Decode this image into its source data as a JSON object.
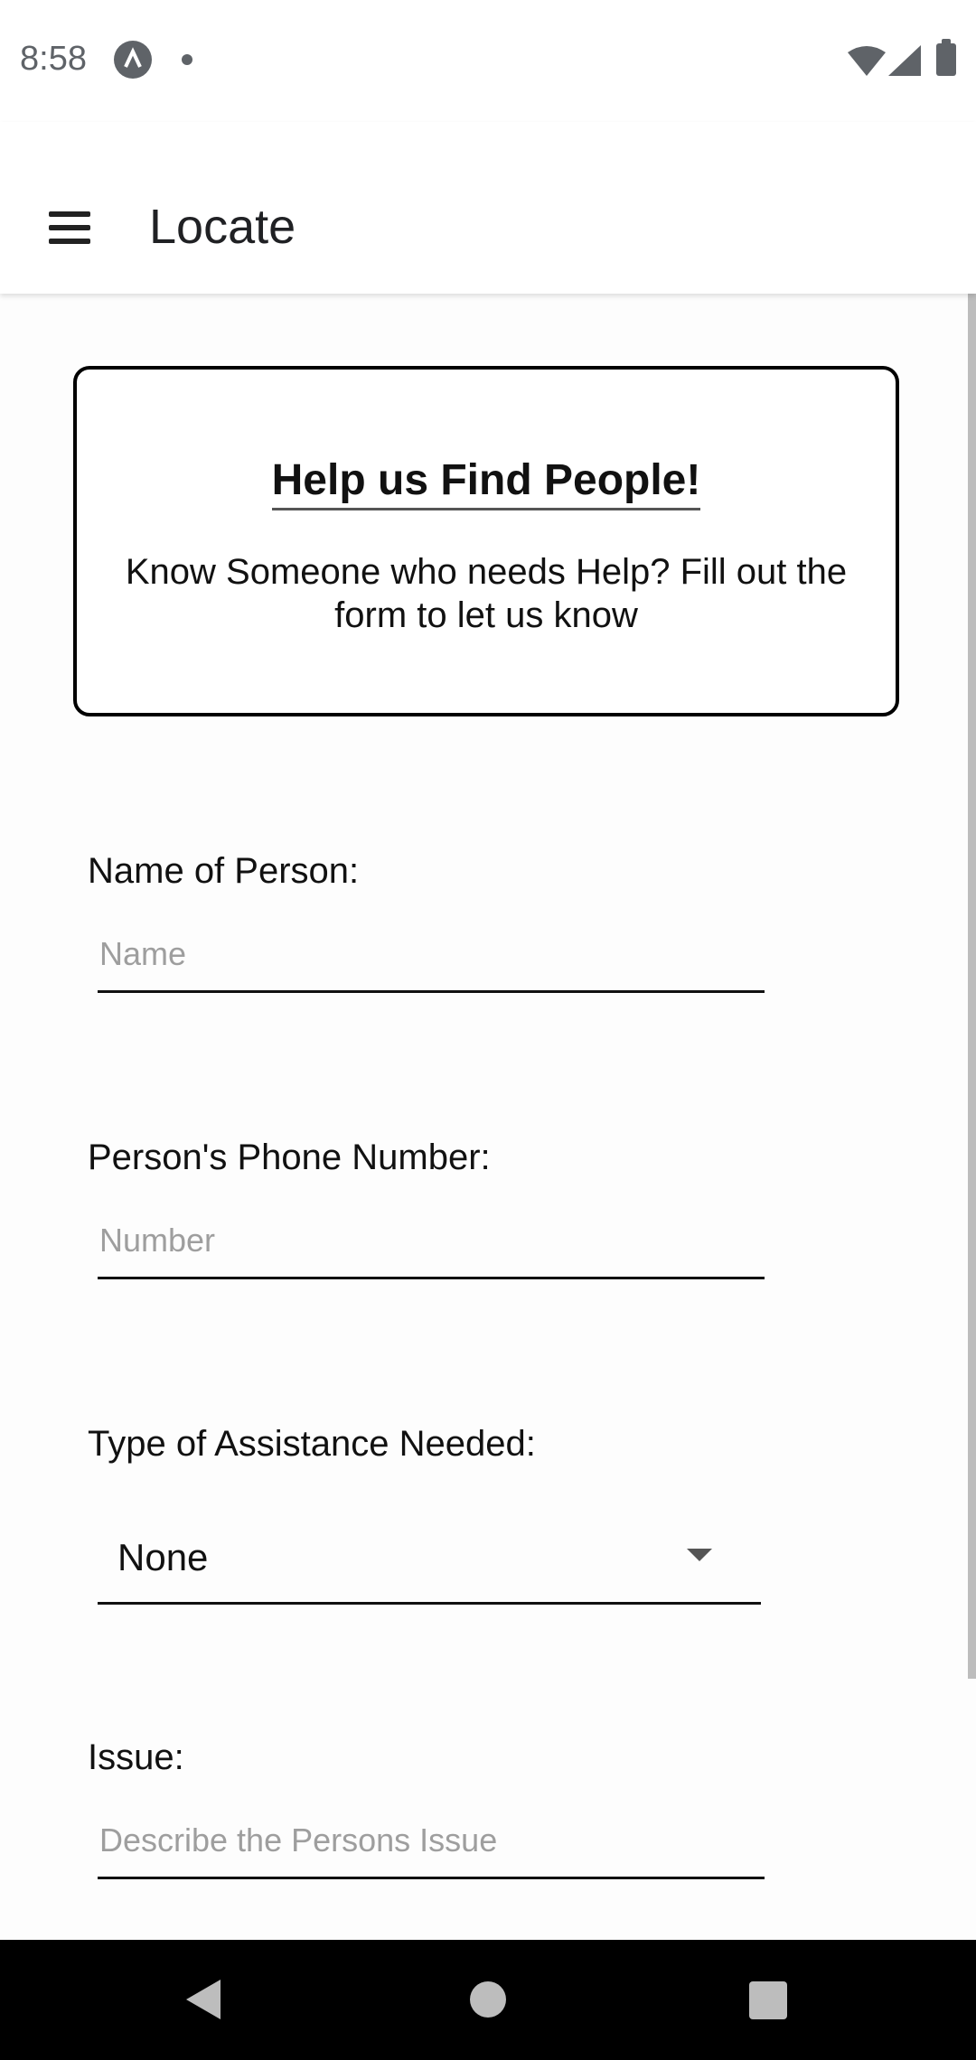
{
  "status_bar": {
    "time": "8:58",
    "icons": [
      "app-notification-icon",
      "dot-icon",
      "wifi-icon",
      "signal-icon",
      "battery-icon"
    ]
  },
  "app_bar": {
    "title": "Locate",
    "menu_icon": "menu-icon"
  },
  "help_card": {
    "title": "Help us Find People!",
    "subtitle": "Know Someone who needs Help? Fill out the form to let us know"
  },
  "form": {
    "name": {
      "label": "Name of Person:",
      "placeholder": "Name",
      "value": ""
    },
    "phone": {
      "label": "Person's Phone Number:",
      "placeholder": "Number",
      "value": ""
    },
    "assistance": {
      "label": "Type of Assistance Needed:",
      "selected": "None"
    },
    "issue": {
      "label": "Issue:",
      "placeholder": "Describe the Persons Issue",
      "value": ""
    }
  },
  "nav_bar": {
    "icons": [
      "back-icon",
      "home-icon",
      "recents-icon"
    ]
  },
  "colors": {
    "status_icon": "#5f6368",
    "placeholder": "#9e9e9e",
    "nav_background": "#000000",
    "nav_icon": "#bdbdbd"
  }
}
